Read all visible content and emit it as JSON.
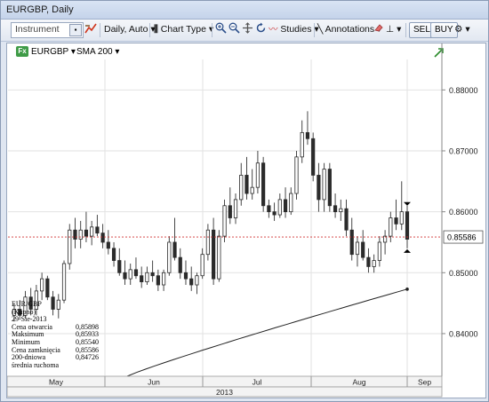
{
  "window": {
    "title": "EURGBP, Daily"
  },
  "toolbar": {
    "instrument_placeholder": "Instrument",
    "period": "Daily, Auto",
    "chart_type": "Chart Type",
    "studies": "Studies",
    "annotations": "Annotations",
    "sell": "SELL",
    "buy": "BUY"
  },
  "legend": {
    "symbol": "EURGBP",
    "study": "SMA 200",
    "badge": "Fx"
  },
  "chart_data": {
    "type": "candlestick",
    "symbol": "EURGBP",
    "interval": "Daily",
    "y_axis": {
      "min": 0.833,
      "max": 0.885,
      "ticks": [
        "0.88000",
        "0.87000",
        "0.86000",
        "0.85000",
        "0.84000"
      ],
      "position": "right"
    },
    "x_axis": {
      "months": [
        "May",
        "Jun",
        "Jul",
        "Aug",
        "Sep"
      ],
      "year": "2013"
    },
    "last_price_label": "0.85586",
    "last_price": 0.85586,
    "candles": [
      [
        0.843,
        0.845,
        0.842,
        0.844
      ],
      [
        0.844,
        0.8455,
        0.8425,
        0.843
      ],
      [
        0.843,
        0.847,
        0.8425,
        0.846
      ],
      [
        0.846,
        0.8475,
        0.843,
        0.844
      ],
      [
        0.844,
        0.848,
        0.843,
        0.847
      ],
      [
        0.847,
        0.85,
        0.8455,
        0.849
      ],
      [
        0.849,
        0.8495,
        0.8455,
        0.846
      ],
      [
        0.846,
        0.847,
        0.843,
        0.844
      ],
      [
        0.844,
        0.8465,
        0.8425,
        0.8455
      ],
      [
        0.8455,
        0.852,
        0.845,
        0.8515
      ],
      [
        0.8515,
        0.858,
        0.8505,
        0.857
      ],
      [
        0.857,
        0.859,
        0.854,
        0.8555
      ],
      [
        0.8555,
        0.8585,
        0.854,
        0.857
      ],
      [
        0.857,
        0.86,
        0.855,
        0.856
      ],
      [
        0.856,
        0.8585,
        0.8545,
        0.8575
      ],
      [
        0.8575,
        0.8595,
        0.856,
        0.8565
      ],
      [
        0.8565,
        0.858,
        0.854,
        0.855
      ],
      [
        0.855,
        0.857,
        0.853,
        0.854
      ],
      [
        0.854,
        0.855,
        0.851,
        0.852
      ],
      [
        0.852,
        0.854,
        0.8495,
        0.85
      ],
      [
        0.85,
        0.852,
        0.848,
        0.849
      ],
      [
        0.849,
        0.8515,
        0.848,
        0.8505
      ],
      [
        0.8505,
        0.8525,
        0.849,
        0.8495
      ],
      [
        0.8495,
        0.851,
        0.8475,
        0.8485
      ],
      [
        0.8485,
        0.851,
        0.848,
        0.85
      ],
      [
        0.85,
        0.852,
        0.8485,
        0.8495
      ],
      [
        0.8495,
        0.8505,
        0.847,
        0.848
      ],
      [
        0.848,
        0.8505,
        0.847,
        0.85
      ],
      [
        0.85,
        0.856,
        0.8495,
        0.855
      ],
      [
        0.855,
        0.859,
        0.852,
        0.8525
      ],
      [
        0.8525,
        0.854,
        0.849,
        0.85
      ],
      [
        0.85,
        0.852,
        0.848,
        0.849
      ],
      [
        0.849,
        0.851,
        0.847,
        0.848
      ],
      [
        0.848,
        0.85,
        0.8465,
        0.8495
      ],
      [
        0.8495,
        0.854,
        0.849,
        0.853
      ],
      [
        0.853,
        0.858,
        0.852,
        0.857
      ],
      [
        0.857,
        0.859,
        0.848,
        0.849
      ],
      [
        0.849,
        0.857,
        0.8485,
        0.856
      ],
      [
        0.856,
        0.862,
        0.855,
        0.861
      ],
      [
        0.861,
        0.864,
        0.858,
        0.859
      ],
      [
        0.859,
        0.863,
        0.858,
        0.862
      ],
      [
        0.862,
        0.868,
        0.861,
        0.866
      ],
      [
        0.866,
        0.869,
        0.862,
        0.863
      ],
      [
        0.863,
        0.867,
        0.862,
        0.864
      ],
      [
        0.864,
        0.87,
        0.863,
        0.868
      ],
      [
        0.868,
        0.869,
        0.86,
        0.861
      ],
      [
        0.861,
        0.862,
        0.859,
        0.86
      ],
      [
        0.86,
        0.8615,
        0.8585,
        0.8595
      ],
      [
        0.8595,
        0.863,
        0.859,
        0.862
      ],
      [
        0.862,
        0.864,
        0.859,
        0.86
      ],
      [
        0.86,
        0.864,
        0.8595,
        0.863
      ],
      [
        0.863,
        0.87,
        0.862,
        0.869
      ],
      [
        0.869,
        0.875,
        0.868,
        0.873
      ],
      [
        0.873,
        0.8765,
        0.871,
        0.872
      ],
      [
        0.872,
        0.873,
        0.865,
        0.866
      ],
      [
        0.866,
        0.868,
        0.86,
        0.862
      ],
      [
        0.862,
        0.868,
        0.86,
        0.867
      ],
      [
        0.867,
        0.868,
        0.86,
        0.861
      ],
      [
        0.861,
        0.863,
        0.859,
        0.86
      ],
      [
        0.86,
        0.862,
        0.8585,
        0.8605
      ],
      [
        0.8605,
        0.862,
        0.856,
        0.857
      ],
      [
        0.857,
        0.859,
        0.852,
        0.853
      ],
      [
        0.853,
        0.856,
        0.851,
        0.855
      ],
      [
        0.855,
        0.857,
        0.852,
        0.8525
      ],
      [
        0.8525,
        0.854,
        0.85,
        0.851
      ],
      [
        0.851,
        0.853,
        0.85,
        0.852
      ],
      [
        0.852,
        0.856,
        0.851,
        0.855
      ],
      [
        0.855,
        0.857,
        0.853,
        0.856
      ],
      [
        0.856,
        0.86,
        0.855,
        0.859
      ],
      [
        0.859,
        0.862,
        0.857,
        0.858
      ],
      [
        0.858,
        0.865,
        0.857,
        0.86
      ],
      [
        0.86,
        0.861,
        0.854,
        0.8555
      ]
    ],
    "sma200": {
      "name": "SMA 200",
      "start": 0.833,
      "end": 0.8473
    },
    "info_box": {
      "pair": "EUR/GBP",
      "side": "(Kupno)",
      "date": "29-Sie-2013",
      "rows": [
        {
          "label": "Cena otwarcia",
          "value": "0,85898"
        },
        {
          "label": "Maksimum",
          "value": "0,85933"
        },
        {
          "label": "Minimum",
          "value": "0,85540"
        },
        {
          "label": "Cena zamknięcia",
          "value": "0,85586"
        },
        {
          "label": "200-dniowa",
          "value": "0,84726"
        },
        {
          "label": "średnia ruchoma",
          "value": ""
        }
      ]
    }
  }
}
